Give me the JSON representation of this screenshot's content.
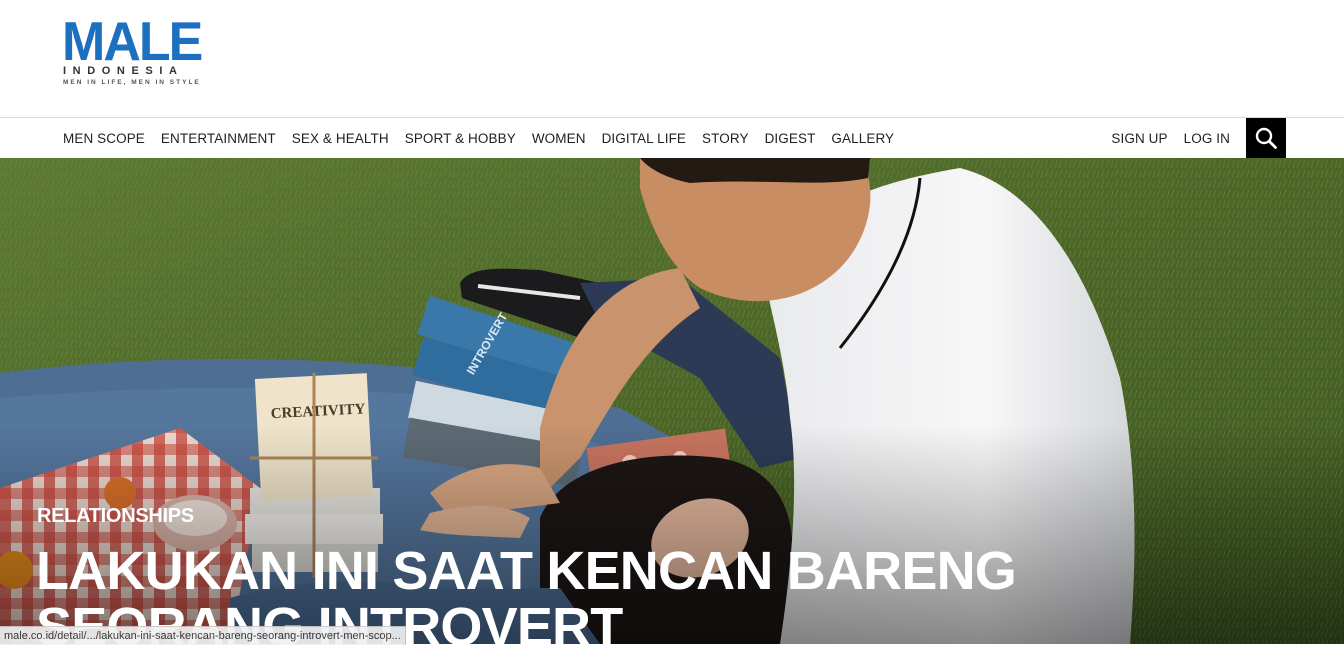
{
  "brand": {
    "name": "MALE",
    "sub": "INDONESIA",
    "tagline": "MEN IN LIFE, MEN IN STYLE",
    "color": "#1d6fbf"
  },
  "nav": {
    "items": [
      "MEN SCOPE",
      "ENTERTAINMENT",
      "SEX & HEALTH",
      "SPORT & HOBBY",
      "WOMEN",
      "DIGITAL LIFE",
      "STORY",
      "DIGEST",
      "GALLERY"
    ],
    "sign_up": "SIGN UP",
    "log_in": "LOG IN",
    "search_icon": "search-icon"
  },
  "hero": {
    "category": "RELATIONSHIPS",
    "title": "LAKUKAN INI SAAT KENCAN BARENG SEORANG INTROVERT",
    "book_text_1": "CREATIVITY",
    "book_text_2": "INTROVERT"
  },
  "status": {
    "url": "male.co.id/detail/.../lakukan-ini-saat-kencan-bareng-seorang-introvert-men-scop..."
  }
}
